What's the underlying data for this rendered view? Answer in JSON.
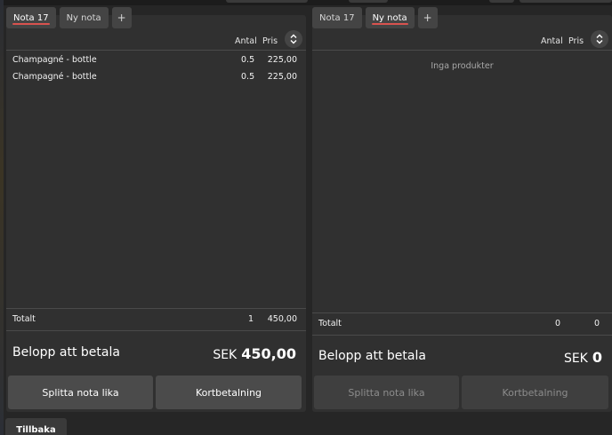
{
  "left_note": {
    "tabs": [
      {
        "label": "Nota 17",
        "active": true
      },
      {
        "label": "Ny nota",
        "active": false
      },
      {
        "label": "+",
        "active": false
      }
    ],
    "columns": {
      "qty": "Antal",
      "price": "Pris"
    },
    "items": [
      {
        "name": "Champagné - bottle",
        "qty": "0.5",
        "price": "225,00"
      },
      {
        "name": "Champagné - bottle",
        "qty": "0.5",
        "price": "225,00"
      }
    ],
    "total": {
      "label": "Totalt",
      "qty": "1",
      "amount": "450,00"
    },
    "payment": {
      "label": "Belopp att betala",
      "currency": "SEK",
      "amount": "450,00"
    },
    "buttons": {
      "split": "Splitta nota lika",
      "card": "Kortbetalning"
    }
  },
  "right_note": {
    "tabs": [
      {
        "label": "Nota 17",
        "active": false
      },
      {
        "label": "Ny nota",
        "active": true
      },
      {
        "label": "+",
        "active": false
      }
    ],
    "columns": {
      "qty": "Antal",
      "price": "Pris"
    },
    "empty_text": "Inga produkter",
    "total": {
      "label": "Totalt",
      "qty": "0",
      "amount": "0"
    },
    "payment": {
      "label": "Belopp att betala",
      "currency": "SEK",
      "amount": "0"
    },
    "buttons": {
      "split": "Splitta nota lika",
      "card": "Kortbetalning"
    }
  },
  "footer": {
    "back_label": "Tillbaka"
  },
  "colors": {
    "active_tab_underline": "#d9534f",
    "panel": "#303030",
    "button": "#4b4b4b"
  }
}
